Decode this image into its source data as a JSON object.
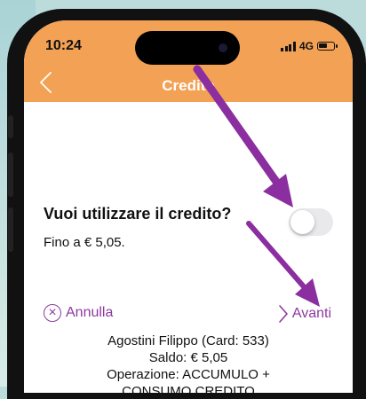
{
  "status": {
    "time": "10:24",
    "network": "4G"
  },
  "header": {
    "title": "Credito",
    "bg_color": "#f3a154"
  },
  "prompt": {
    "question": "Vuoi utilizzare il credito?",
    "limit": "Fino a € 5,05."
  },
  "toggle": {
    "on": false
  },
  "actions": {
    "cancel_label": "Annulla",
    "next_label": "Avanti",
    "accent_color": "#8d3a9f"
  },
  "info": {
    "customer": "Agostini Filippo (Card: 533)",
    "balance": "Saldo: € 5,05",
    "operation": "Operazione: ACCUMULO +",
    "operation_detail": "CONSUMO CREDITO"
  },
  "annotation_arrow_color": "#8b2ea0"
}
